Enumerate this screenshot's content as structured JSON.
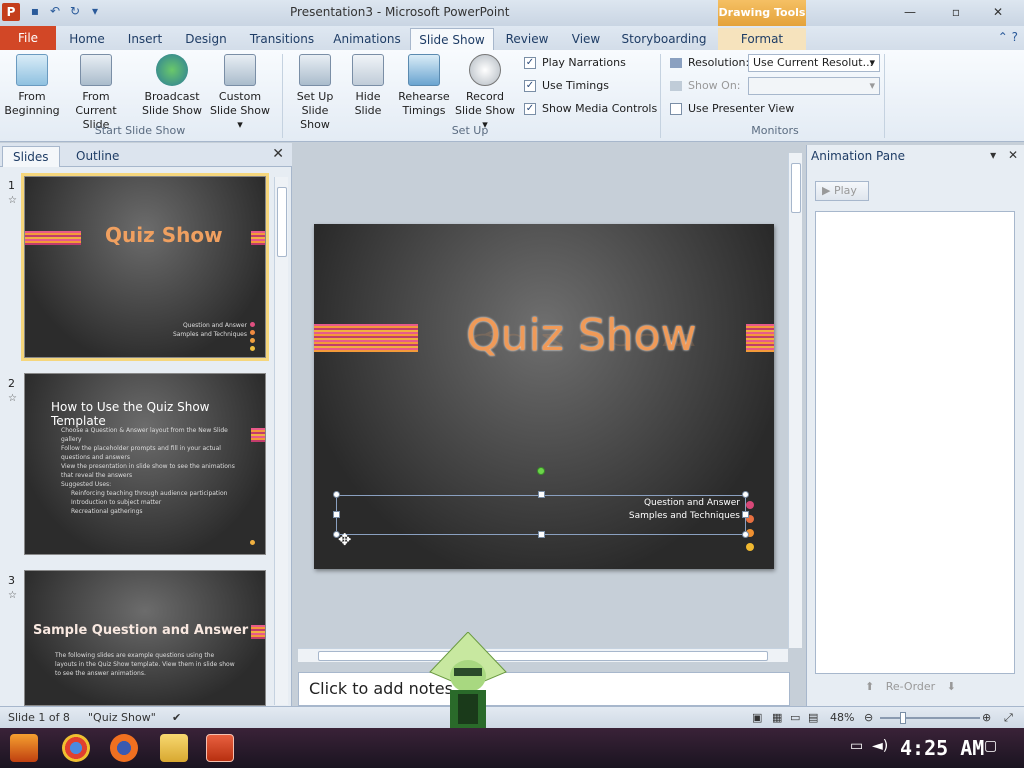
{
  "window": {
    "title": "Presentation3 - Microsoft PowerPoint",
    "context_tab": "Drawing Tools",
    "app_icon": "P"
  },
  "tabs": [
    "File",
    "Home",
    "Insert",
    "Design",
    "Transitions",
    "Animations",
    "Slide Show",
    "Review",
    "View",
    "Storyboarding",
    "Format"
  ],
  "ribbon": {
    "start": {
      "from_beginning": "From Beginning",
      "from_current_1": "From Current",
      "from_current_2": "Slide",
      "broadcast_1": "Broadcast",
      "broadcast_2": "Slide Show",
      "custom_1": "Custom",
      "custom_2": "Slide Show",
      "label": "Start Slide Show"
    },
    "setup": {
      "setup_1": "Set Up",
      "setup_2": "Slide Show",
      "hide_1": "Hide",
      "hide_2": "Slide",
      "rehearse_1": "Rehearse",
      "rehearse_2": "Timings",
      "record_1": "Record",
      "record_2": "Slide Show",
      "play_narrations": "Play Narrations",
      "use_timings": "Use Timings",
      "show_media": "Show Media Controls",
      "label": "Set Up"
    },
    "monitors": {
      "resolution_label": "Resolution:",
      "resolution_value": "Use Current Resolut...",
      "show_on_label": "Show On:",
      "presenter_view": "Use Presenter View",
      "label": "Monitors"
    }
  },
  "left_panel": {
    "tab_slides": "Slides",
    "tab_outline": "Outline",
    "thumbs": [
      {
        "num": "1",
        "title": "Quiz Show",
        "sub1": "Question and Answer",
        "sub2": "Samples and Techniques"
      },
      {
        "num": "2",
        "heading": "How to Use the Quiz Show Template",
        "bullets": [
          "Choose a Question & Answer layout from the New Slide gallery",
          "Follow the placeholder prompts and fill in your actual questions and answers",
          "View the presentation in slide show to see the animations that reveal the answers",
          "Suggested Uses:",
          "Reinforcing teaching through audience participation",
          "Introduction to subject matter",
          "Recreational gatherings"
        ]
      },
      {
        "num": "3",
        "heading": "Sample Question and Answer",
        "body": "The following slides are example questions using the layouts in the Quiz Show template. View them in slide show to see the answer animations."
      }
    ]
  },
  "slide": {
    "title": "Quiz Show",
    "subtitle1": "Question and Answer",
    "subtitle2": "Samples and Techniques"
  },
  "notes_placeholder": "Click to add notes",
  "anim_pane": {
    "title": "Animation Pane",
    "play": "Play",
    "reorder": "Re-Order"
  },
  "status": {
    "slide_of": "Slide 1 of 8",
    "theme": "\"Quiz Show\"",
    "zoom": "48%"
  },
  "taskbar": {
    "clock": "4:25 AM"
  },
  "colors": {
    "accent_file": "#d24726",
    "title_orange": "#f09a58",
    "drawing_tools": "#e4a23a"
  }
}
